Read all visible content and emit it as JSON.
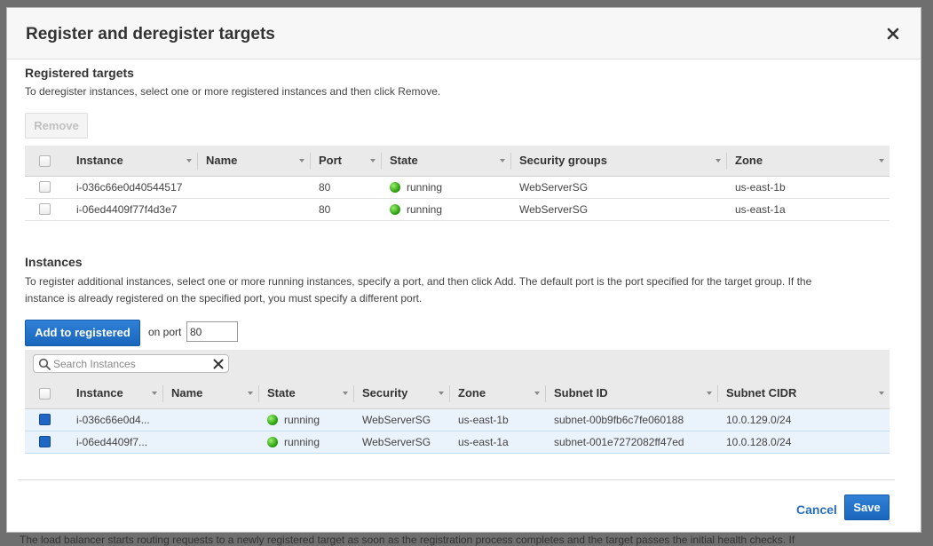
{
  "background_text": "The load balancer starts routing requests to a newly registered target as soon as the registration process completes and the target passes the initial health checks. If",
  "modal": {
    "title": "Register and deregister targets",
    "close_icon": "close-icon"
  },
  "registered": {
    "title": "Registered targets",
    "help": "To deregister instances, select one or more registered instances and then click Remove.",
    "remove_label": "Remove",
    "columns": [
      "Instance",
      "Name",
      "Port",
      "State",
      "Security groups",
      "Zone"
    ],
    "rows": [
      {
        "instance": "i-036c66e0d40544517",
        "name": "",
        "port": "80",
        "state": "running",
        "sg": "WebServerSG",
        "zone": "us-east-1b"
      },
      {
        "instance": "i-06ed4409f77f4d3e7",
        "name": "",
        "port": "80",
        "state": "running",
        "sg": "WebServerSG",
        "zone": "us-east-1a"
      }
    ]
  },
  "instances": {
    "title": "Instances",
    "help_line1": "To register additional instances, select one or more running instances, specify a port, and then click Add. The default port is the port specified for the target group. If the",
    "help_line2": "instance is already registered on the specified port, you must specify a different port.",
    "add_label": "Add to registered",
    "port_label": "on port",
    "port_value": "80",
    "search_placeholder": "Search Instances",
    "columns": [
      "Instance",
      "Name",
      "State",
      "Security",
      "Zone",
      "Subnet ID",
      "Subnet CIDR"
    ],
    "rows": [
      {
        "instance": "i-036c66e0d4...",
        "name": "",
        "state": "running",
        "sg": "WebServerSG",
        "zone": "us-east-1b",
        "subnet": "subnet-00b9fb6c7fe060188",
        "cidr": "10.0.129.0/24",
        "checked": true
      },
      {
        "instance": "i-06ed4409f7...",
        "name": "",
        "state": "running",
        "sg": "WebServerSG",
        "zone": "us-east-1a",
        "subnet": "subnet-001e7272082ff47ed",
        "cidr": "10.0.128.0/24",
        "checked": true
      }
    ]
  },
  "footer": {
    "cancel_label": "Cancel",
    "save_label": "Save"
  },
  "colors": {
    "primary": "#1f6fce",
    "running": "#2ea312",
    "link": "#2a6fbd"
  }
}
